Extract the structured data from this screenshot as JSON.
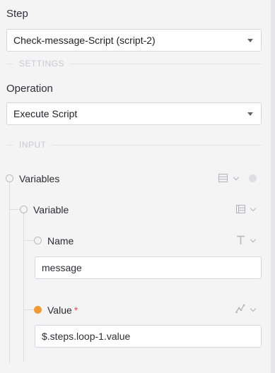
{
  "step": {
    "label": "Step",
    "selected": "Check-message-Script (script-2)"
  },
  "settings_section": {
    "label": "SETTINGS"
  },
  "operation": {
    "label": "Operation",
    "selected": "Execute Script"
  },
  "input_section": {
    "label": "INPUT"
  },
  "tree": {
    "variables": {
      "label": "Variables",
      "icon": "list-icon"
    },
    "variable": {
      "label": "Variable",
      "icon": "object-list-icon"
    },
    "name_field": {
      "label": "Name",
      "type_icon": "text-type-icon",
      "value": "message"
    },
    "value_field": {
      "label": "Value",
      "required_mark": "*",
      "type_icon": "expression-icon",
      "value": "$.steps.loop-1.value",
      "status_color": "#f09a37"
    }
  },
  "colors": {
    "background": "#f4f4f5",
    "border": "#d6d6dc",
    "accent": "#f09a37",
    "required": "#e0524a"
  }
}
